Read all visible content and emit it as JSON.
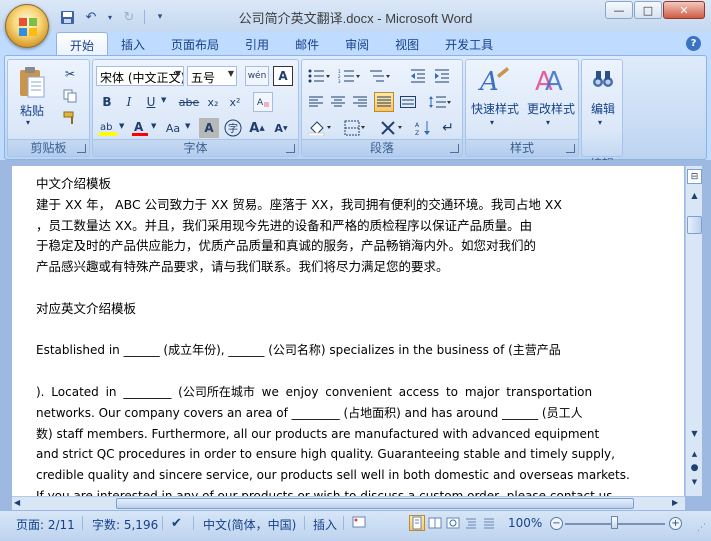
{
  "window": {
    "title": "公司简介英文翻译.docx - Microsoft Word",
    "min": "—",
    "max": "□",
    "close": "✕"
  },
  "qat": {
    "customize": "▾"
  },
  "tabs": [
    "开始",
    "插入",
    "页面布局",
    "引用",
    "邮件",
    "审阅",
    "视图",
    "开发工具"
  ],
  "ribbon": {
    "clipboard": {
      "label": "剪贴板",
      "paste": "粘贴"
    },
    "font": {
      "label": "字体",
      "font_name": "宋体 (中文正文)",
      "font_size": "五号",
      "bold": "B",
      "italic": "I",
      "underline": "U",
      "strike": "abe",
      "subscript": "x₂",
      "superscript": "x²",
      "clear": "Aa",
      "char_border": "A",
      "phonetic": "wén",
      "grow": "A",
      "shrink": "A",
      "circle": "字"
    },
    "paragraph": {
      "label": "段落"
    },
    "styles": {
      "label": "样式",
      "quick_styles": "快速样式",
      "change_styles": "更改样式"
    },
    "editing": {
      "label": "编辑",
      "editing_btn": "编辑"
    }
  },
  "document": {
    "lines": [
      "中文介绍模板",
      "建于 XX 年， ABC 公司致力于 XX 贸易。座落于 XX，我司拥有便利的交通环境。我司占地 XX",
      "，员工数量达 XX。并且，我们采用现今先进的设备和严格的质检程序以保证产品质量。由",
      "于稳定及时的产品供应能力，优质产品质量和真诚的服务，产品畅销海内外。如您对我们的",
      "产品感兴趣或有特殊产品要求，请与我们联系。我们将尽力满足您的要求。",
      "",
      "对应英文介绍模板",
      "",
      "Established in ______ (成立年份), ______ (公司名称) specializes in the business of (主营产品",
      "",
      "). Located in ________ (公司所在城市 we enjoy convenient access to major transportation",
      "networks. Our company covers an area of ________ (占地面积) and has around ______ (员工人",
      "数) staff   members. Furthermore, all our products are manufactured with advanced equipment",
      "and strict QC procedures in order to ensure high quality. Guaranteeing stable and timely supply,",
      "credible quality and sincere service, our products sell well in both domestic and overseas markets.",
      "If you are interested in any of our products or wish to discuss a custom order, please contact us."
    ]
  },
  "status": {
    "page": "页面: 2/11",
    "words": "字数: 5,196",
    "language": "中文(简体，中国)",
    "mode": "插入",
    "zoom": "100%",
    "zoom_value": 100
  },
  "colors": {
    "accent": "#15428b",
    "ribbon": "#dbe7f8",
    "highlight": "#ffff00",
    "font_color": "#ff0000"
  }
}
